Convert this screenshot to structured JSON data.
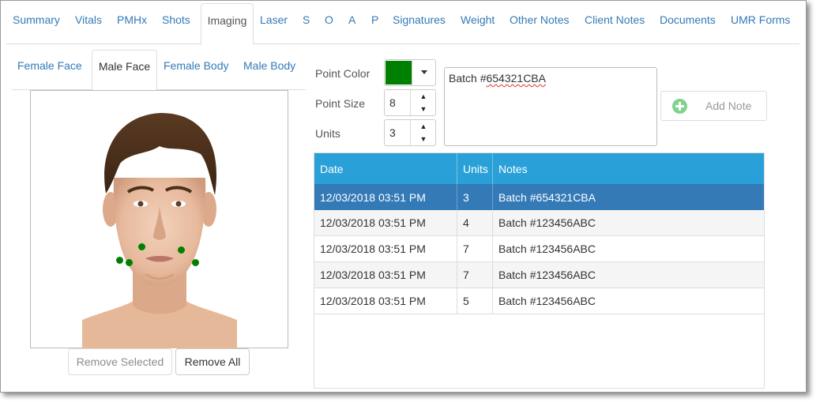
{
  "tabs": [
    {
      "label": "Summary"
    },
    {
      "label": "Vitals"
    },
    {
      "label": "PMHx"
    },
    {
      "label": "Shots"
    },
    {
      "label": "Imaging"
    },
    {
      "label": "Laser"
    },
    {
      "label": "S"
    },
    {
      "label": "O"
    },
    {
      "label": "A"
    },
    {
      "label": "P"
    },
    {
      "label": "Signatures"
    },
    {
      "label": "Weight"
    },
    {
      "label": "Other Notes"
    },
    {
      "label": "Client Notes"
    },
    {
      "label": "Documents"
    },
    {
      "label": "UMR Forms"
    }
  ],
  "active_tab": "Imaging",
  "image_tabs": [
    {
      "label": "Female Face"
    },
    {
      "label": "Male Face"
    },
    {
      "label": "Female Body"
    },
    {
      "label": "Male Body"
    }
  ],
  "active_image_tab": "Male Face",
  "image_buttons": {
    "remove_selected": "Remove Selected",
    "remove_all": "Remove All"
  },
  "controls": {
    "point_color_label": "Point Color",
    "point_color_value": "#008000",
    "point_size_label": "Point Size",
    "point_size_value": "8",
    "units_label": "Units",
    "units_value": "3",
    "note_prefix": "Batch #",
    "note_code": "654321CBA",
    "add_note_label": "Add Note"
  },
  "table": {
    "headers": [
      "Date",
      "Units",
      "Notes"
    ],
    "rows": [
      {
        "date": "12/03/2018 03:51 PM",
        "units": "3",
        "notes": "Batch #654321CBA",
        "selected": true
      },
      {
        "date": "12/03/2018 03:51 PM",
        "units": "4",
        "notes": "Batch #123456ABC"
      },
      {
        "date": "12/03/2018 03:51 PM",
        "units": "7",
        "notes": "Batch #123456ABC"
      },
      {
        "date": "12/03/2018 03:51 PM",
        "units": "7",
        "notes": "Batch #123456ABC"
      },
      {
        "date": "12/03/2018 03:51 PM",
        "units": "5",
        "notes": "Batch #123456ABC"
      }
    ]
  },
  "colors": {
    "link": "#337ab7",
    "table_header": "#29a0d8",
    "selected_row": "#337ab7",
    "point": "#008000"
  }
}
